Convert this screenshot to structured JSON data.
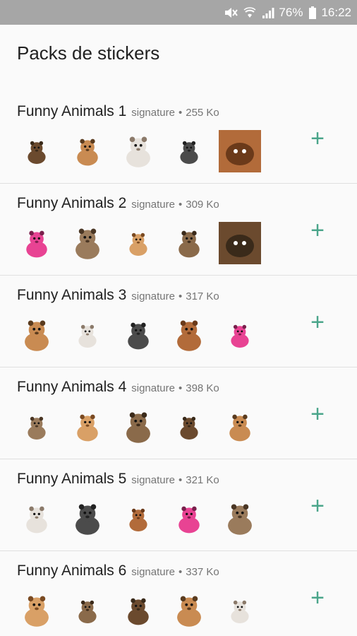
{
  "status_bar": {
    "battery": "76%",
    "time": "16:22",
    "icons": [
      "mute-icon",
      "wifi-icon",
      "signal-icon",
      "battery-icon"
    ]
  },
  "header": {
    "title": "Packs de stickers"
  },
  "accent_color": "#4aa58a",
  "packs": [
    {
      "name": "Funny Animals 1",
      "author": "signature",
      "separator": "•",
      "size": "255 Ko",
      "stickers": [
        "squirrel-sticker",
        "squirrel-sticker",
        "cat-sticker",
        "cat-sticker",
        "black-cat-sticker"
      ]
    },
    {
      "name": "Funny Animals 2",
      "author": "signature",
      "separator": "•",
      "size": "309 Ko",
      "stickers": [
        "pink-animal-sticker",
        "pug-sticker",
        "dog-in-hat-sticker",
        "dog-sticker",
        "dog-sticker"
      ]
    },
    {
      "name": "Funny Animals 3",
      "author": "signature",
      "separator": "•",
      "size": "317 Ko",
      "stickers": [
        "guinea-pig-sticker",
        "hamster-sticker",
        "cat-sticker",
        "cat-sticker",
        "dog-sticker"
      ]
    },
    {
      "name": "Funny Animals 4",
      "author": "signature",
      "separator": "•",
      "size": "398 Ko",
      "stickers": [
        "bear-sticker",
        "pug-sticker",
        "otter-sticker",
        "bear-sticker",
        "hamster-sticker"
      ]
    },
    {
      "name": "Funny Animals 5",
      "author": "signature",
      "separator": "•",
      "size": "321 Ko",
      "stickers": [
        "lizard-sticker",
        "hamster-sticker",
        "hamster-sticker",
        "alpaca-sticker",
        "alpaca-sticker"
      ]
    },
    {
      "name": "Funny Animals 6",
      "author": "signature",
      "separator": "•",
      "size": "337 Ko",
      "stickers": [
        "giraffe-sticker",
        "llama-sticker",
        "dog-sticker",
        "pug-sticker",
        "llama-sticker"
      ]
    }
  ],
  "add_label": "+"
}
